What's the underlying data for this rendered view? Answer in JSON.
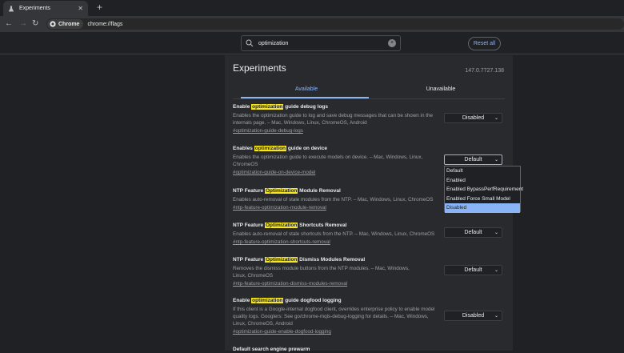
{
  "browser": {
    "tab_title": "Experiments",
    "tab_close": "✕",
    "new_tab": "+",
    "chip_label": "Chrome",
    "url": "chrome://flags"
  },
  "search": {
    "value": "optimization",
    "clear": "×"
  },
  "reset_label": "Reset all",
  "page": {
    "title": "Experiments",
    "version": "147.0.7727.138",
    "tab_available": "Available",
    "tab_unavailable": "Unavailable"
  },
  "flags": [
    {
      "title_before": "Enable ",
      "highlight": "optimization",
      "title_after": " guide debug logs",
      "description": "Enables the optimization guide to log and save debug messages that can be shown in the internals page. – Mac, Windows, Linux, ChromeOS, Android",
      "link": "#optimization-guide-debug-logs",
      "value": "Disabled"
    },
    {
      "title_before": "Enables ",
      "highlight": "optimization",
      "title_after": " guide on device",
      "description": "Enables the optimization guide to execute models on device. – Mac, Windows, Linux, ChromeOS",
      "link": "#optimization-guide-on-device-model",
      "value": "Default"
    },
    {
      "title_before": "NTP Feature ",
      "highlight": "Optimization",
      "title_after": " Module Removal",
      "description": "Enables auto-removal of stale modules from the NTP. – Mac, Windows, Linux, ChromeOS",
      "link": "#ntp-feature-optimization-module-removal",
      "value": ""
    },
    {
      "title_before": "NTP Feature ",
      "highlight": "Optimization",
      "title_after": " Shortcuts Removal",
      "description": "Enables auto-removal of stale shortcuts from the NTP. – Mac, Windows, Linux, ChromeOS",
      "link": "#ntp-feature-optimization-shortcuts-removal",
      "value": "Default"
    },
    {
      "title_before": "NTP Feature ",
      "highlight": "Optimization",
      "title_after": " Dismiss Modules Removal",
      "description": "Removes the dismiss module buttons from the NTP modules. – Mac, Windows, Linux, ChromeOS",
      "link": "#ntp-feature-optimization-dismiss-modules-removal",
      "value": "Default"
    },
    {
      "title_before": "Enable ",
      "highlight": "optimization",
      "title_after": " guide dogfood logging",
      "description": "If this client is a Google-internal dogfood client, overrides enterprise policy to enable model quality logs. Googlers: See go/chrome-mqls-debug-logging for details. – Mac, Windows, Linux, ChromeOS, Android",
      "link": "#optimization-guide-enable-dogfood-logging",
      "value": "Disabled"
    },
    {
      "title_before": "Default search engine prewarm",
      "highlight": "",
      "title_after": "",
      "description": "",
      "link": "",
      "value": ""
    }
  ],
  "dropdown_options": [
    "Default",
    "Enabled",
    "Enabled BypassPerfRequirement",
    "Enabled Force Small Model",
    "Disabled"
  ],
  "dropdown_selected_index": 4,
  "caret": "⌄",
  "icons": {
    "tab": "flask-icon",
    "back": "←",
    "forward": "→",
    "reload": "↻"
  }
}
